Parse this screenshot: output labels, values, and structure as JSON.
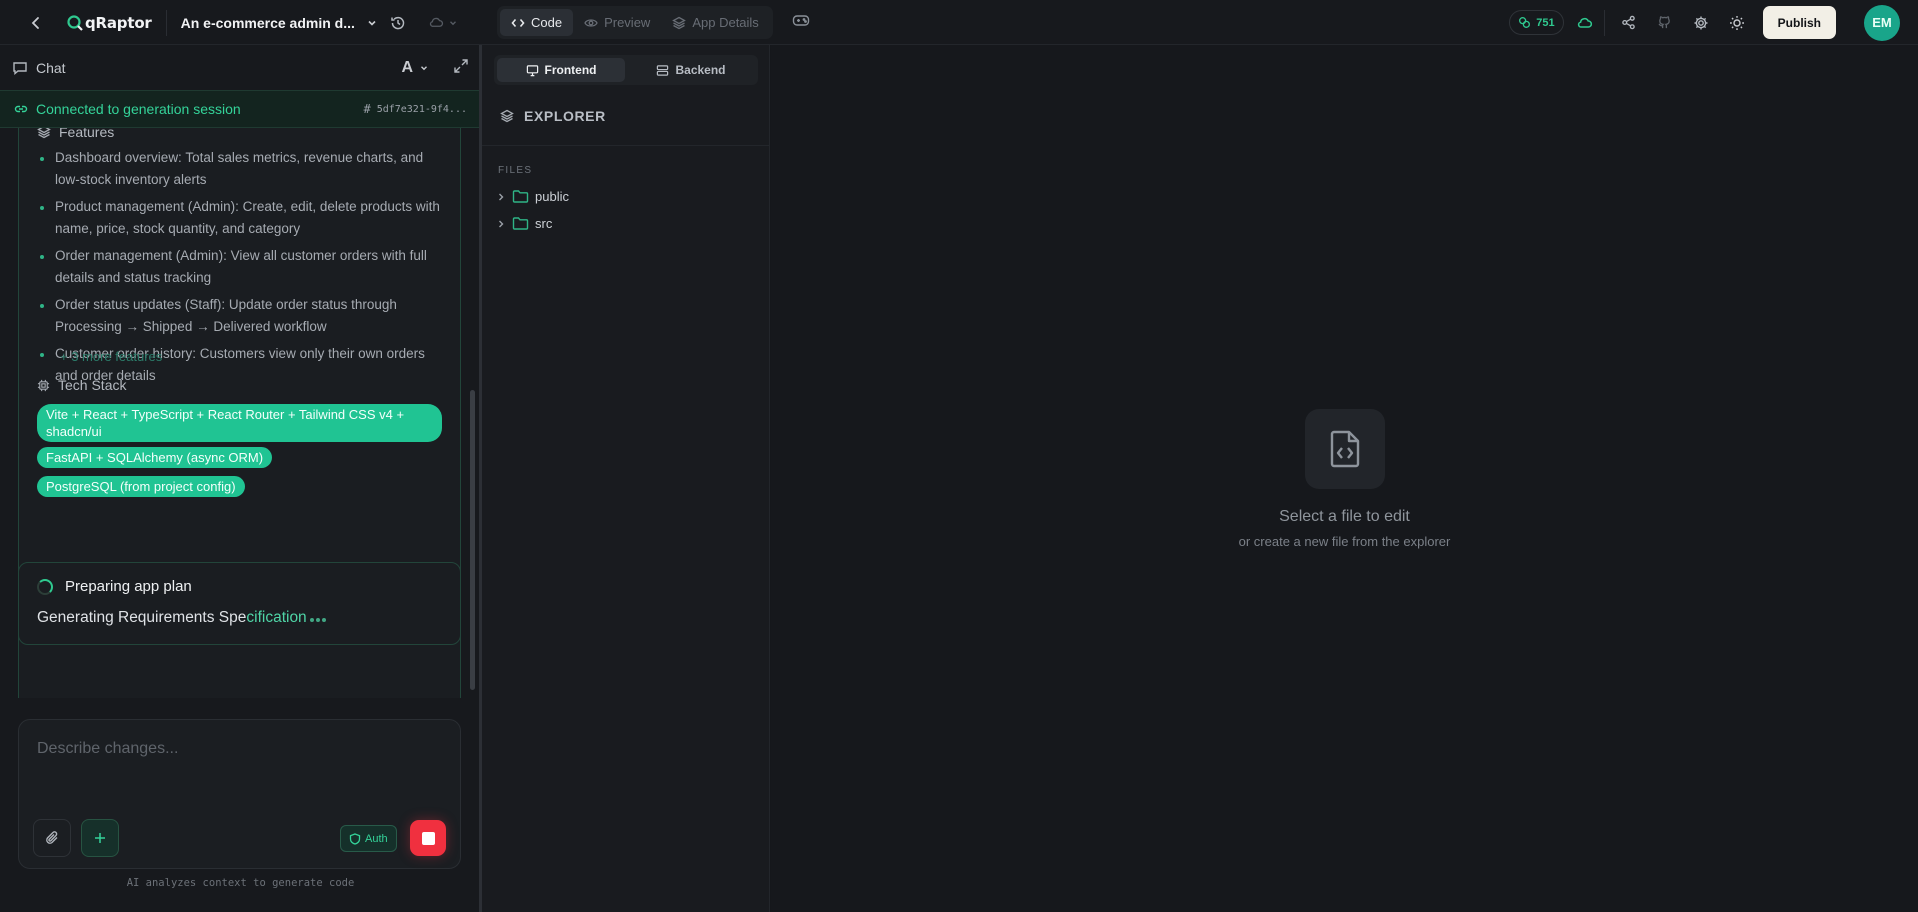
{
  "topbar": {
    "logo": "qRaptor",
    "app_title": "An e-commerce admin d...",
    "modes": [
      {
        "label": "Code",
        "active": true
      },
      {
        "label": "Preview",
        "active": false
      },
      {
        "label": "App Details",
        "active": false
      }
    ],
    "credits": "751",
    "publish_label": "Publish",
    "avatar_initials": "EM"
  },
  "chat": {
    "header_label": "Chat",
    "font_label": "A",
    "connection_status": "Connected to generation session",
    "session_id": "5df7e321-9f4...",
    "features_heading": "Features",
    "features": [
      "Dashboard overview: Total sales metrics, revenue charts, and low-stock inventory alerts",
      "Product management (Admin): Create, edit, delete products with name, price, stock quantity, and category",
      "Order management (Admin): View all customer orders with full details and status tracking",
      "Order status updates (Staff): Update order status through Processing → Shipped → Delivered workflow",
      "Customer order history: Customers view only their own orders and order details"
    ],
    "more_features": "+ 3 more features",
    "tech_heading": "Tech Stack",
    "tech_stack": [
      "Vite + React + TypeScript + React Router + Tailwind CSS v4 + shadcn/ui",
      "FastAPI + SQLAlchemy (async ORM)",
      "PostgreSQL (from project config)"
    ],
    "plan_title": "Preparing app plan",
    "plan_status_a": "Generating Requirements Spe",
    "plan_status_b": "cification",
    "composer_placeholder": "Describe changes...",
    "auth_label": "Auth",
    "hint": "AI analyzes context to generate code"
  },
  "explorer": {
    "tabs": [
      {
        "label": "Frontend",
        "active": true
      },
      {
        "label": "Backend",
        "active": false
      }
    ],
    "title": "EXPLORER",
    "files_label": "FILES",
    "folders": [
      "public",
      "src"
    ]
  },
  "editor": {
    "empty_title": "Select a file to edit",
    "empty_subtitle": "or create a new file from the explorer"
  },
  "colors": {
    "accent": "#20c493",
    "accent_text": "#34d399",
    "stop": "#f0303f",
    "avatar": "#19a58a"
  }
}
